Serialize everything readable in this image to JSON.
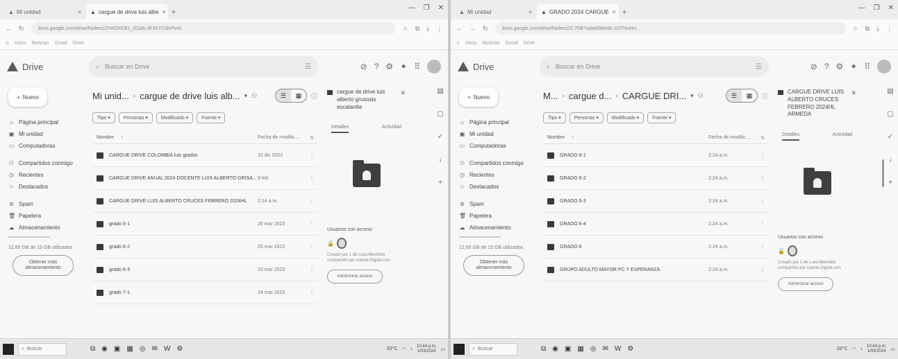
{
  "shots": [
    {
      "browser": {
        "tabs": [
          {
            "label": "Mi unidad",
            "active": false
          },
          {
            "label": "cargue de drive luis albe",
            "active": true
          }
        ],
        "url": "drive.google.com/drive/folders/1Fe6OtS3l1_2OdA-Jfr3XYCdhFhn0",
        "bookmarks": [
          "Inicio",
          "Noticias",
          "Gmail",
          "Drive",
          "Aplicaciones"
        ]
      },
      "drive": {
        "logo_text": "Drive",
        "search_placeholder": "Buscar en Drive",
        "new_label": "Nuevo",
        "nav": [
          "Página principal",
          "Mi unidad",
          "Computadoras",
          "Compartidos conmigo",
          "Recientes",
          "Destacados",
          "Spam",
          "Papelera",
          "Almacenamiento"
        ],
        "storage_text": "12,65 GB de 15 GB utilizados",
        "get_storage": "Obtener más almacenamiento",
        "breadcrumb_root": "Mi unid...",
        "breadcrumb_current": "cargue de drive luis alb...",
        "filters": [
          "Tipo",
          "Personas",
          "Modificado",
          "Fuente"
        ],
        "col_name": "Nombre",
        "col_date": "Fecha de modific...",
        "rows": [
          {
            "name": "CARGUE DRIVE COLOMBIA luis grados",
            "date": "15 dic 2023"
          },
          {
            "name": "CARGUE DRIVE ANUAL 2024 DOCENTE LUIS ALBERTO GRISA...",
            "date": "9 feb"
          },
          {
            "name": "CARGUE DRIVE LUIS ALBERTO CRUCES FEBRERO 2024HL",
            "date": "2:14 a.m."
          },
          {
            "name": "grado 6-1",
            "date": "26 mar 2023"
          },
          {
            "name": "grado 6-2",
            "date": "25 mar 2023"
          },
          {
            "name": "grado 6-3",
            "date": "19 mar 2023"
          },
          {
            "name": "grado 7-1",
            "date": "24 mar 2023"
          }
        ],
        "details": {
          "title": "cargue de drive luis alberto grusosis escalantte",
          "tab_details": "Detalles",
          "tab_activity": "Actividad",
          "access_label": "Usuarios con acceso",
          "access_text": "Creado por 1 de Luis/Albertobo compartido por cuenta Digital.com",
          "manage_label": "Administrar acceso"
        }
      },
      "taskbar": {
        "search": "Buscar",
        "time": "10:44 p.m.",
        "date": "1/03/2024",
        "weather": "20°C"
      }
    },
    {
      "browser": {
        "tabs": [
          {
            "label": "Mi unidad",
            "active": false
          },
          {
            "label": "GRADO 2024 CARGUE",
            "active": true
          }
        ],
        "url": "drive.google.com/drive/folders/1C7hlEYadwl3Wx0b-1OTNuNm",
        "bookmarks": [
          "Inicio",
          "Noticias",
          "Gmail",
          "Drive",
          "Aplicaciones"
        ]
      },
      "drive": {
        "logo_text": "Drive",
        "search_placeholder": "Buscar en Drive",
        "new_label": "Nuevo",
        "nav": [
          "Página principal",
          "Mi unidad",
          "Computadoras",
          "Compartidos conmigo",
          "Recientes",
          "Destacados",
          "Spam",
          "Papelera",
          "Almacenamiento"
        ],
        "storage_text": "12,65 GB de 15 GB utilizados",
        "get_storage": "Obtener más almacenamiento",
        "breadcrumb_root": "M...",
        "breadcrumb_mid": "cargue d...",
        "breadcrumb_current": "CARGUE DRI...",
        "filters": [
          "Tipo",
          "Personas",
          "Modificado",
          "Fuente"
        ],
        "col_name": "Nombre",
        "col_date": "Fecha de modific...",
        "rows": [
          {
            "name": "GRADO 6-1",
            "date": "2:24 a.m."
          },
          {
            "name": "GRADO 6-2",
            "date": "2:24 a.m."
          },
          {
            "name": "GRADO 6-3",
            "date": "2:24 a.m."
          },
          {
            "name": "GRADO 6-4",
            "date": "2:24 a.m."
          },
          {
            "name": "GRADO 6",
            "date": "2:24 a.m."
          },
          {
            "name": "GRUPO ADULTO MAYOR PC Y ESPERANZA",
            "date": "2:24 a.m."
          }
        ],
        "details": {
          "title": "CARGUE DRIVE LUIS ALBERTO CRUCES FEBRERO 2024HL ARMEDA",
          "tab_details": "Detalles",
          "tab_activity": "Actividad",
          "access_label": "Usuarios con acceso",
          "access_text": "Creado por 1 de Luis/Albertobo compartido por cuenta Digital.com",
          "manage_label": "Administrar acceso"
        }
      },
      "taskbar": {
        "search": "Buscar",
        "time": "10:44 p.m.",
        "date": "1/03/2024",
        "weather": "20°C"
      }
    }
  ]
}
